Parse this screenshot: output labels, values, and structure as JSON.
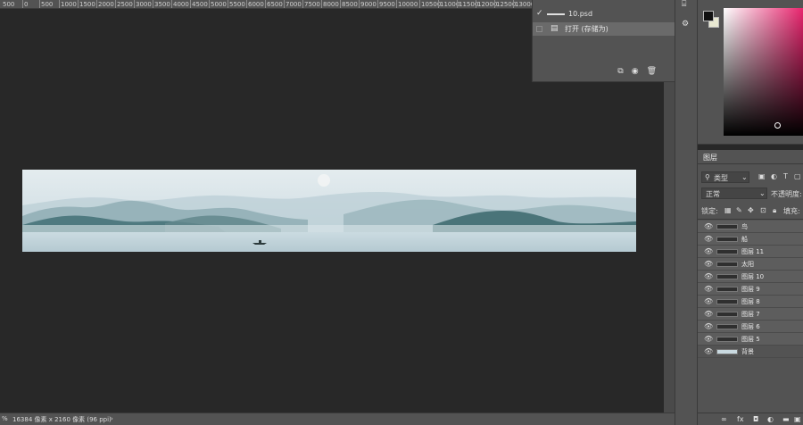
{
  "ruler": {
    "ticks": [
      "500",
      "0",
      "500",
      "1000",
      "1500",
      "2000",
      "2500",
      "3000",
      "3500",
      "4000",
      "4500",
      "5000",
      "5500",
      "6000",
      "6500",
      "7000",
      "7500",
      "8000",
      "8500",
      "9000",
      "9500",
      "10000",
      "10500",
      "11000",
      "11500",
      "12000",
      "12500",
      "13000"
    ]
  },
  "history": {
    "items": [
      {
        "label": "10.psd"
      },
      {
        "label": "打开 (存储为)"
      }
    ]
  },
  "color_panel": {
    "foreground": "#111111",
    "background": "#e9e9d2"
  },
  "layers_panel": {
    "tab": "图层",
    "filter_label": "类型",
    "blend_mode": "正常",
    "opacity_label": "不透明度:",
    "lock_label": "锁定:",
    "fill_label": "填充:",
    "layers": [
      {
        "name": "鸟"
      },
      {
        "name": "船"
      },
      {
        "name": "图层 11"
      },
      {
        "name": "太阳"
      },
      {
        "name": "图层 10"
      },
      {
        "name": "图层 9"
      },
      {
        "name": "图层 8"
      },
      {
        "name": "图层 7"
      },
      {
        "name": "图层 6"
      },
      {
        "name": "图层 5"
      },
      {
        "name": "背景"
      }
    ]
  },
  "status_bar": {
    "zoom": "%",
    "doc_info": "16384 像素 x 2160 像素 (96 ppi)"
  }
}
